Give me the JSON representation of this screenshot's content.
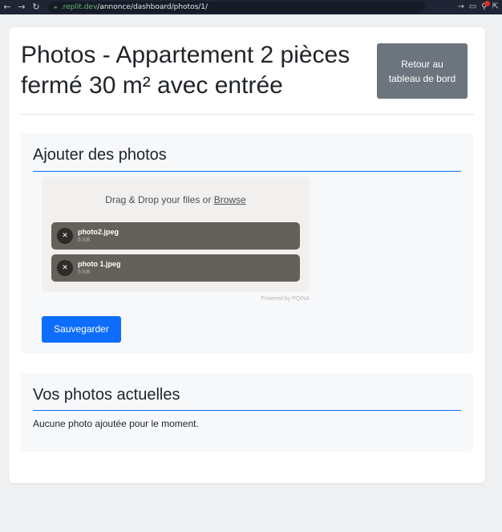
{
  "browser": {
    "back_icon": "arrow-left-icon",
    "forward_icon": "arrow-right-icon",
    "reload_icon": "reload-icon",
    "url_host": ".replit.dev",
    "url_path": "/annonce/dashboard/photos/1/"
  },
  "page": {
    "title": "Photos - Appartement 2 pièces fermé 30 m² avec entrée",
    "back_button": "Retour au tableau de bord"
  },
  "upload_section": {
    "title": "Ajouter des photos",
    "drop_text": "Drag & Drop your files or",
    "browse_text": "Browse",
    "files": [
      {
        "name": "photo2.jpeg",
        "size": "6 KB"
      },
      {
        "name": "photo 1.jpeg",
        "size": "5 KB"
      }
    ],
    "powered_by": "Powered by PQINA",
    "save_button": "Sauvegarder"
  },
  "current_section": {
    "title": "Vos photos actuelles",
    "empty_message": "Aucune photo ajoutée pour le moment."
  },
  "colors": {
    "primary": "#0d6efd",
    "secondary": "#6c757d",
    "accent_rule": "#0d6efd"
  }
}
